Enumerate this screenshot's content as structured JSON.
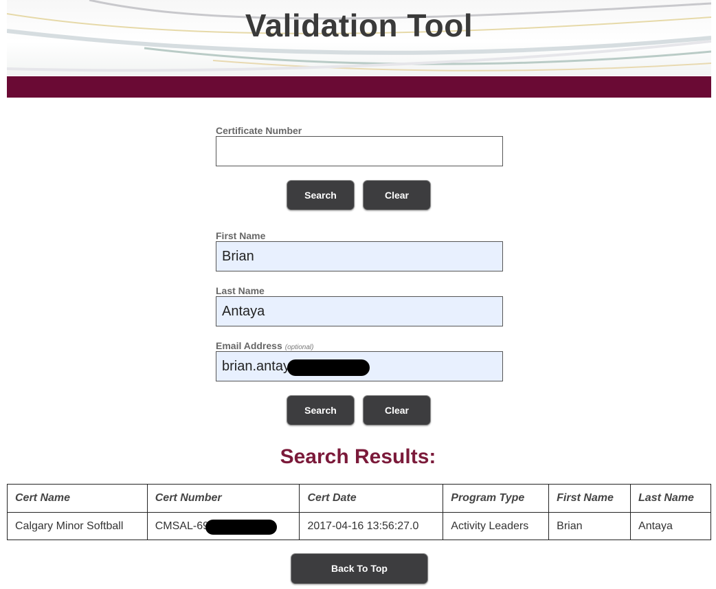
{
  "header": {
    "title": "Validation Tool"
  },
  "cert_search": {
    "label": "Certificate Number",
    "value": "",
    "search_label": "Search",
    "clear_label": "Clear"
  },
  "name_search": {
    "first_name_label": "First Name",
    "first_name_value": "Brian",
    "last_name_label": "Last Name",
    "last_name_value": "Antaya",
    "email_label": "Email Address",
    "email_optional": "(optional)",
    "email_value": "brian.antay",
    "search_label": "Search",
    "clear_label": "Clear"
  },
  "results": {
    "title": "Search Results:",
    "columns": [
      "Cert Name",
      "Cert Number",
      "Cert Date",
      "Program Type",
      "First Name",
      "Last Name"
    ],
    "rows": [
      [
        "Calgary Minor Softball",
        "CMSAL-69",
        "2017-04-16 13:56:27.0",
        "Activity Leaders",
        "Brian",
        "Antaya"
      ]
    ]
  },
  "back_to_top_label": "Back To Top",
  "colors": {
    "band": "#6a0a34",
    "results_title": "#7b1a3a",
    "button": "#3d3d3f"
  }
}
